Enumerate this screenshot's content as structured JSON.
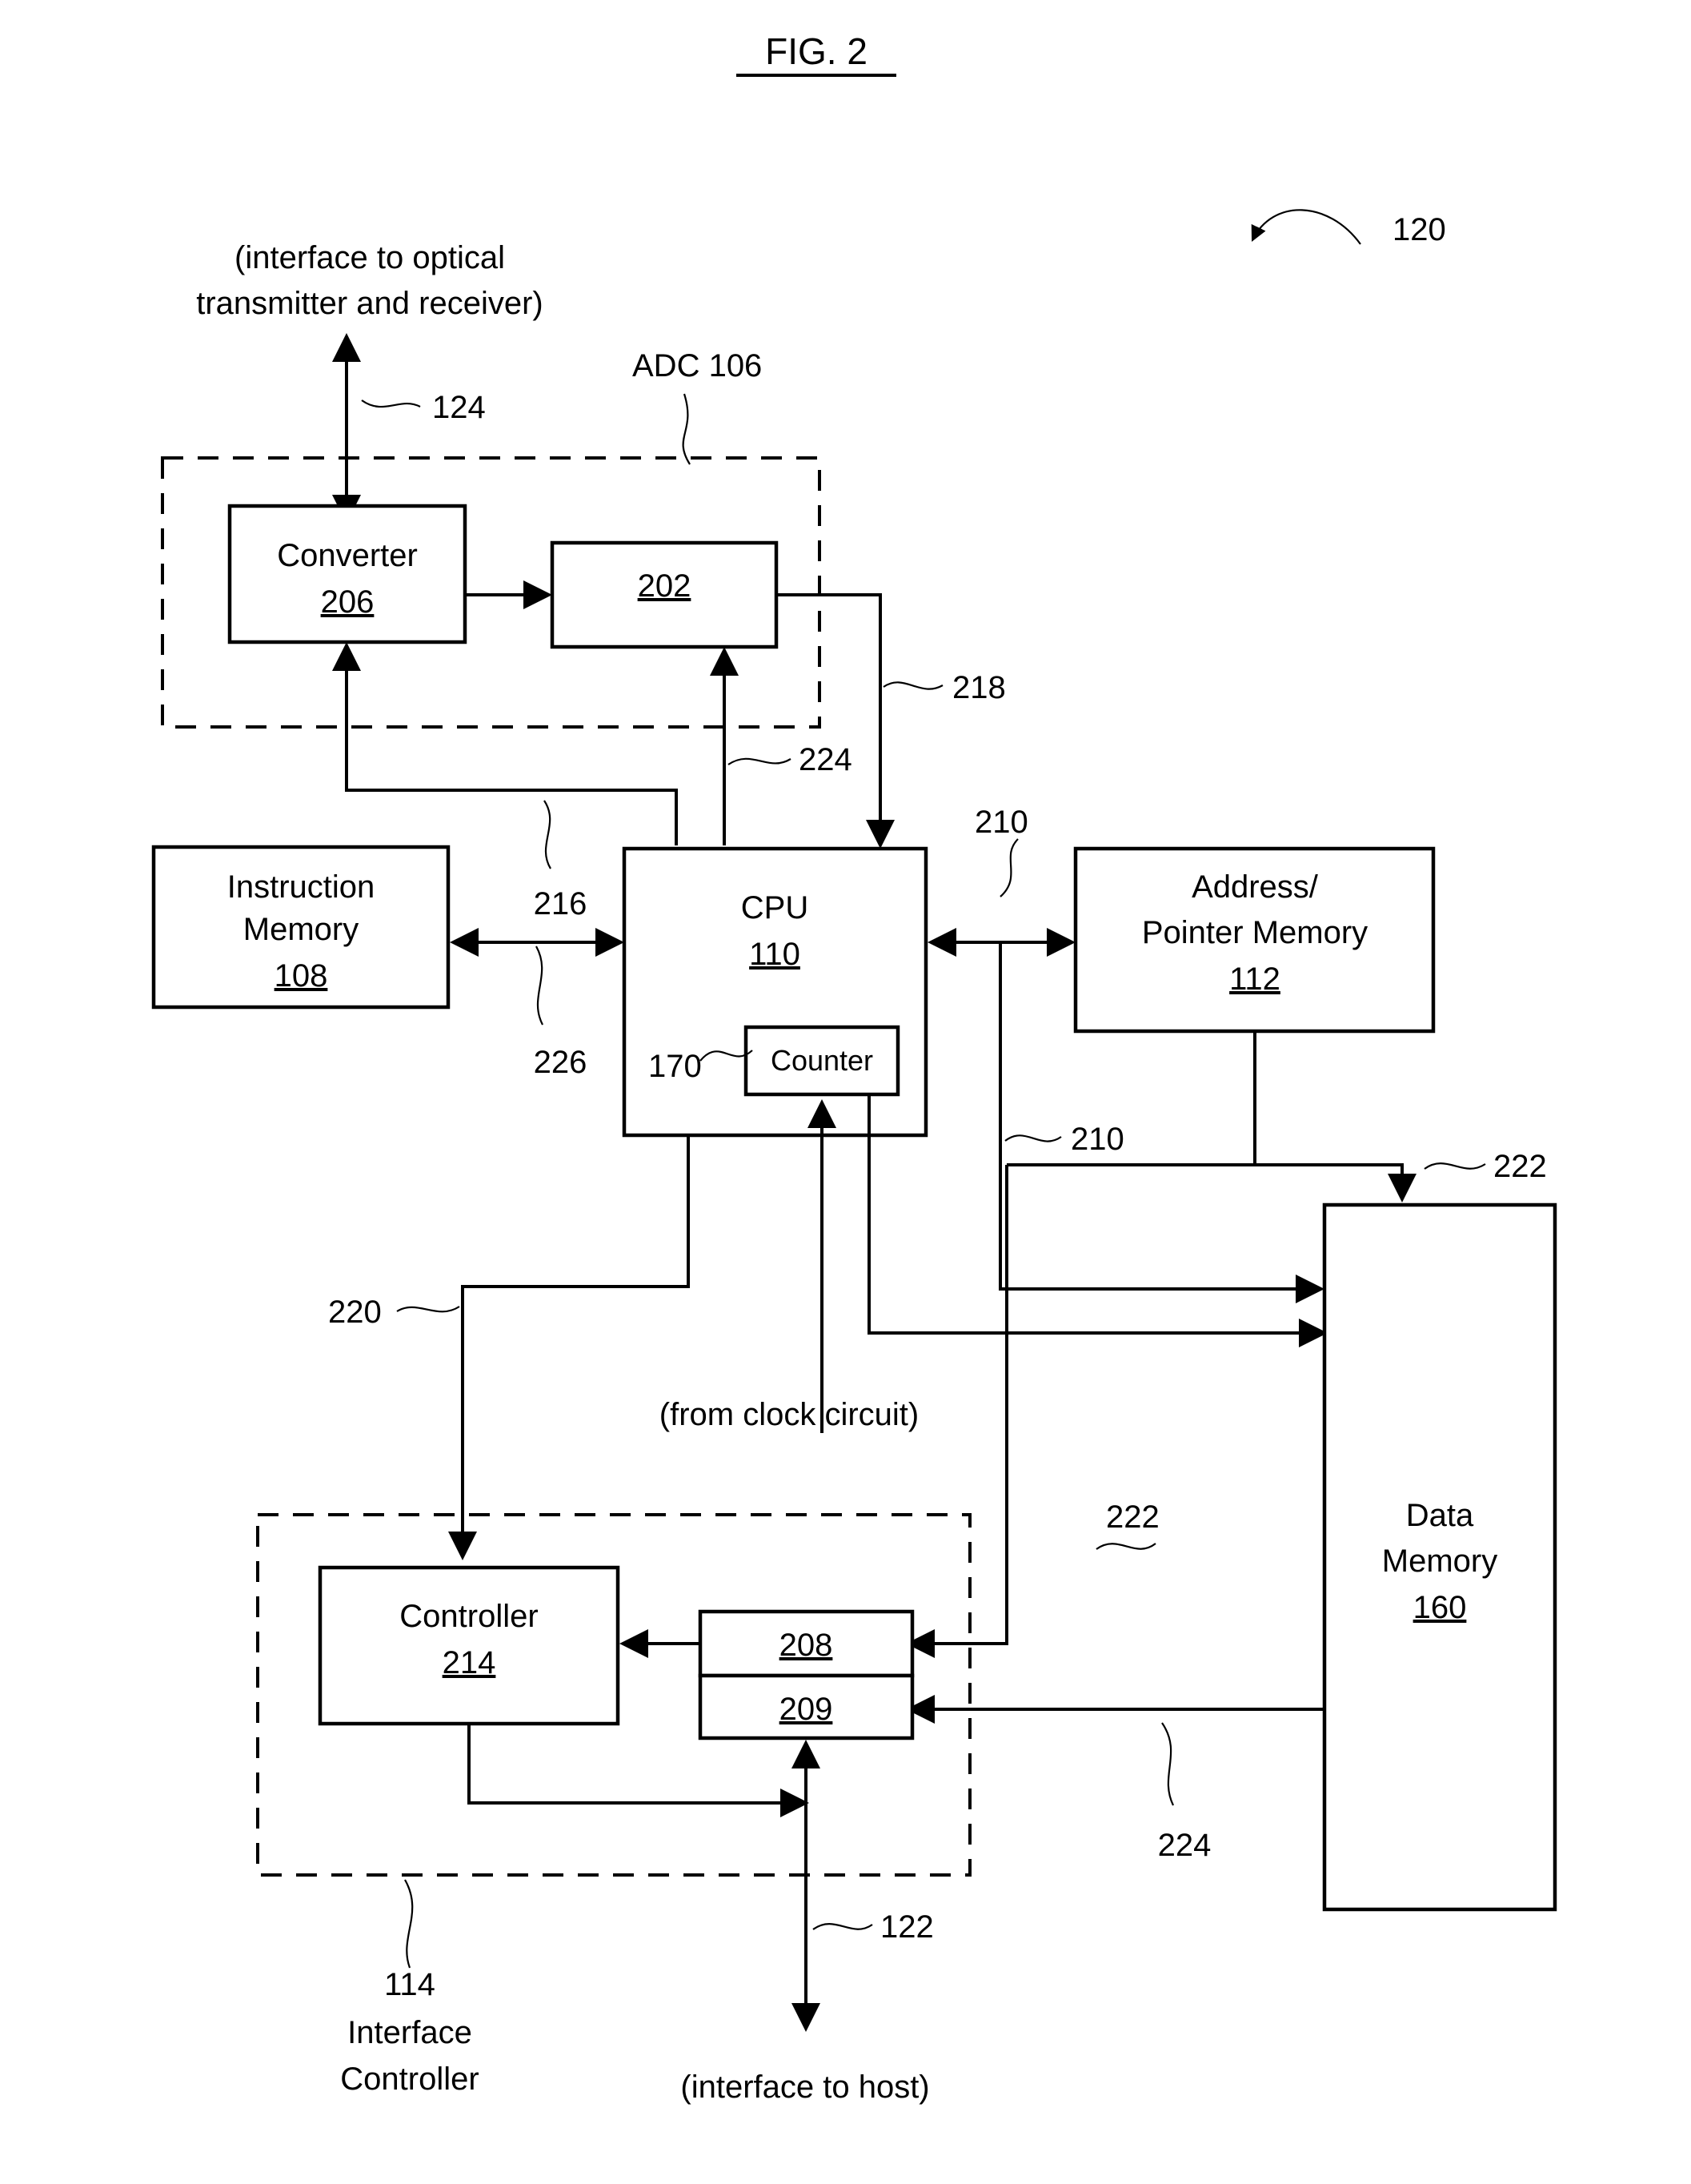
{
  "figure": {
    "title": "FIG. 2",
    "system_ref": "120"
  },
  "notes": {
    "optical_interface_line1": "(interface to optical",
    "optical_interface_line2": "transmitter and receiver)",
    "clock_note": "(from clock circuit)",
    "host_note": "(interface to host)"
  },
  "groups": {
    "adc": {
      "label": "ADC 106"
    },
    "interface_controller": {
      "ref": "114",
      "label_line1": "Interface",
      "label_line2": "Controller"
    }
  },
  "blocks": {
    "converter": {
      "name": "Converter",
      "ref": "206"
    },
    "register_202": {
      "ref": "202"
    },
    "instruction_memory": {
      "line1": "Instruction",
      "line2": "Memory",
      "ref": "108"
    },
    "cpu": {
      "name": "CPU",
      "ref": "110"
    },
    "counter": {
      "name": "Counter",
      "ref": "170"
    },
    "address_pointer_memory": {
      "line1": "Address/",
      "line2": "Pointer Memory",
      "ref": "112"
    },
    "data_memory": {
      "line1": "Data",
      "line2": "Memory",
      "ref": "160"
    },
    "controller": {
      "name": "Controller",
      "ref": "214"
    },
    "buffer_208": {
      "ref": "208"
    },
    "buffer_209": {
      "ref": "209"
    }
  },
  "signal_refs": {
    "optical_bus": "124",
    "adc_out_218": "218",
    "converter_ctrl_216": "216",
    "sample_clk_224": "224",
    "instruction_bus_226": "226",
    "address_bus_210_top": "210",
    "address_bus_210_bottom": "210",
    "data_bus_222_top": "222",
    "data_bus_222_bottom": "222",
    "controller_ctrl_220": "220",
    "data_bus_224_bottom": "224",
    "host_bus_122": "122"
  }
}
